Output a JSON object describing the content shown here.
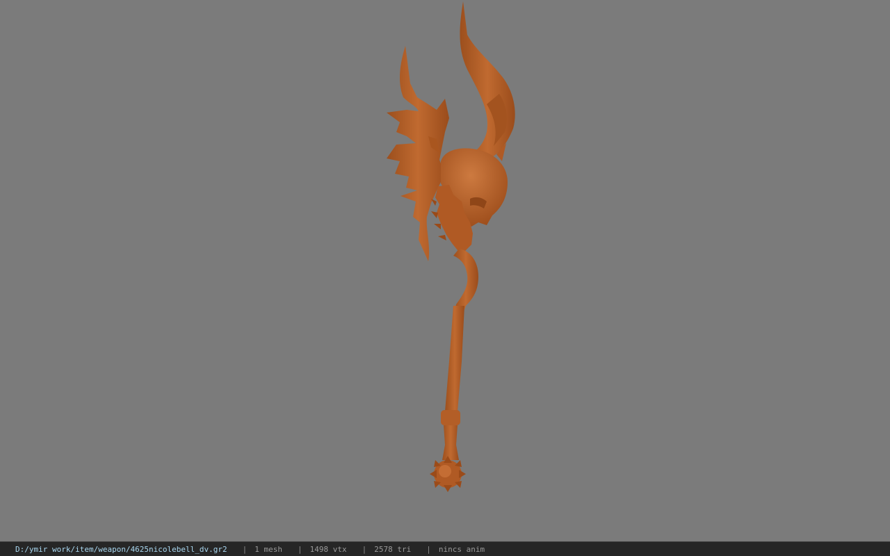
{
  "viewport": {
    "background_color": "#7b7b7b",
    "model_color": "#b8612a",
    "model_shade": "#8f4618",
    "model_highlight": "#cf7a3e"
  },
  "status": {
    "file_path": "D:/ymir work/item/weapon/4625nicolebell_dv.gr2",
    "separator": "|",
    "mesh": "1 mesh",
    "vertices": "1498 vtx",
    "triangles": "2578 tri",
    "animation": "nincs anim"
  }
}
